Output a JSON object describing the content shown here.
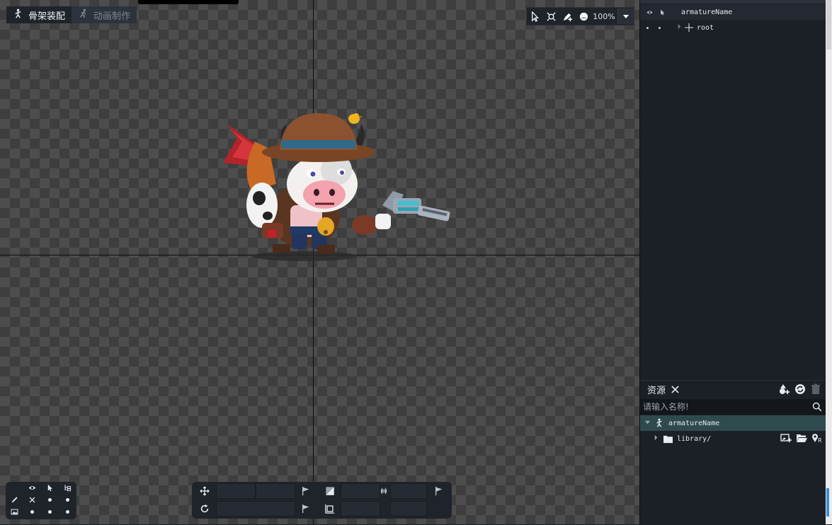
{
  "mode_tabs": {
    "assembly_label": "骨架装配",
    "animation_label": "动画制作"
  },
  "view_toolbar": {
    "zoom": "100%"
  },
  "tree": {
    "armature_label": "armatureName",
    "root_label": "root"
  },
  "assets": {
    "tab_label": "资源",
    "search_placeholder": "请输入名称!",
    "armature_item": "armatureName",
    "library_item": "library/"
  },
  "colors": {
    "panel_bg": "#1b1f26",
    "selected_row": "#2f4a4d",
    "checker_light": "#4d4d4d",
    "checker_dark": "#3e3e3e"
  }
}
